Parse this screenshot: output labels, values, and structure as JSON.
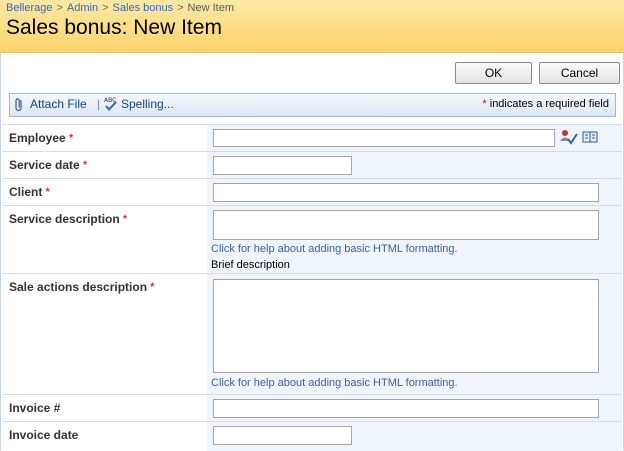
{
  "breadcrumb": {
    "items": [
      "Bellerage",
      "Admin",
      "Sales bonus",
      "New Item"
    ],
    "separator": ">"
  },
  "page_title": "Sales bonus: New Item",
  "buttons": {
    "ok": "OK",
    "cancel": "Cancel"
  },
  "toolbar": {
    "attach_file": "Attach File",
    "divider": "|",
    "spelling": "Spelling...",
    "required_asterisk": "*",
    "required_note": "indicates a required field"
  },
  "fields": [
    {
      "label": "Employee",
      "required": "*",
      "value": ""
    },
    {
      "label": "Service date",
      "required": "*",
      "value": ""
    },
    {
      "label": "Client",
      "required": "*",
      "value": ""
    },
    {
      "label": "Service description",
      "required": "*",
      "value": "",
      "help": "Click for help about adding basic HTML formatting.",
      "note": "Brief description"
    },
    {
      "label": "Sale actions description",
      "required": "*",
      "value": "",
      "help": "Click for help about adding basic HTML formatting."
    },
    {
      "label": "Invoice #",
      "value": ""
    },
    {
      "label": "Invoice date",
      "value": ""
    }
  ],
  "icons": {
    "attach": "paperclip-icon",
    "spelling": "spell-check-icon",
    "check_names": "check-names-icon",
    "browse": "address-book-icon"
  },
  "colors": {
    "header_top": "#fde9a6",
    "header_bottom": "#fbd46b",
    "link": "#3366cc",
    "required": "#cc0000",
    "field_bg": "#f0f4fb"
  }
}
